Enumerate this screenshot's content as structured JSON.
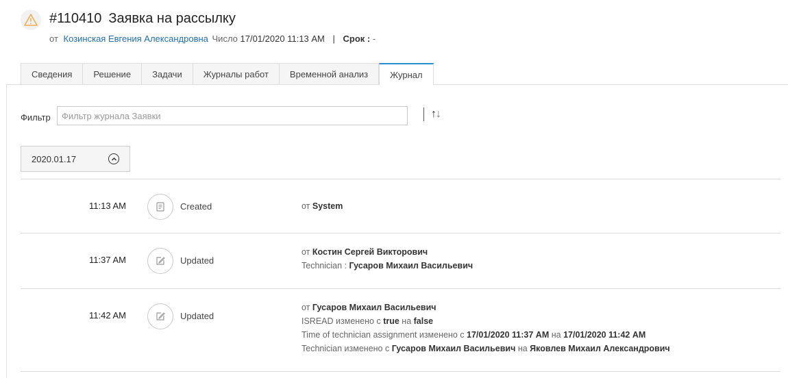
{
  "ticket": {
    "number": "#110410",
    "title": "Заявка на рассылку",
    "from_label": "от",
    "requester": "Козинская Евгения Александровна",
    "date_label": "Число",
    "date_value": "17/01/2020 11:13 AM",
    "separator": "|",
    "due_label": "Срок :",
    "due_value": "-"
  },
  "tabs": [
    {
      "label": "Сведения",
      "active": false
    },
    {
      "label": "Решение",
      "active": false
    },
    {
      "label": "Задачи",
      "active": false
    },
    {
      "label": "Журналы работ",
      "active": false
    },
    {
      "label": "Временной анализ",
      "active": false
    },
    {
      "label": "Журнал",
      "active": true
    }
  ],
  "filter": {
    "label": "Фильтр",
    "placeholder": "Фильтр журнала Заявки",
    "value": "",
    "sort_up": "↑",
    "sort_down": "↓"
  },
  "date_group": {
    "label": "2020.01.17",
    "state": "expanded"
  },
  "entries": [
    {
      "time": "11:13 AM",
      "icon": "document-icon",
      "action": "Created",
      "from_prefix": "от",
      "author": "System",
      "lines": []
    },
    {
      "time": "11:37 AM",
      "icon": "edit-icon",
      "action": "Updated",
      "from_prefix": "от",
      "author": "Костин Сергей Викторович",
      "lines": [
        {
          "prefix": "Technician : ",
          "v1": "Гусаров Михаил Васильевич",
          "mid": "",
          "v2": ""
        }
      ]
    },
    {
      "time": "11:42 AM",
      "icon": "edit-icon",
      "action": "Updated",
      "from_prefix": "от",
      "author": "Гусаров Михаил Васильевич",
      "lines": [
        {
          "prefix": "ISREAD изменено с ",
          "v1": "true",
          "mid": " на ",
          "v2": "false"
        },
        {
          "prefix": "Time of technician assignment изменено с ",
          "v1": "17/01/2020 11:37 AM",
          "mid": " на ",
          "v2": "17/01/2020 11:42 AM"
        },
        {
          "prefix": "Technician изменено с ",
          "v1": "Гусаров Михаил Васильевич",
          "mid": " на ",
          "v2": "Яковлев Михаил Александрович"
        }
      ]
    }
  ],
  "colors": {
    "accent": "#2a8fd0",
    "link": "#1f6fb2",
    "warning": "#f0ad4e"
  }
}
